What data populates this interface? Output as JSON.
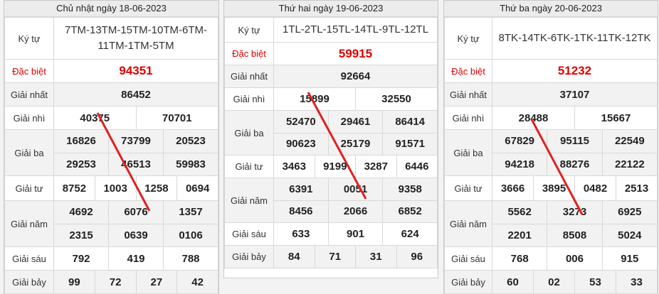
{
  "panels": [
    {
      "date": "Chủ nhật ngày 18-06-2023",
      "kytu_label": "Ký tự",
      "kytu": "7TM-13TM-15TM-10TM-6TM-11TM-1TM-5TM",
      "rows": [
        {
          "label": "Đặc biệt",
          "values": [
            "94351"
          ]
        },
        {
          "label": "Giải nhất",
          "values": [
            "86452"
          ]
        },
        {
          "label": "Giải nhì",
          "values": [
            "40375",
            "70701"
          ]
        },
        {
          "label": "Giải ba",
          "values": [
            "16826",
            "73799",
            "20523",
            "29253",
            "46513",
            "59983"
          ]
        },
        {
          "label": "Giải tư",
          "values": [
            "8752",
            "1003",
            "1258",
            "0694"
          ]
        },
        {
          "label": "Giải năm",
          "values": [
            "4692",
            "6076",
            "1357",
            "2315",
            "0639",
            "0106"
          ]
        },
        {
          "label": "Giải sáu",
          "values": [
            "792",
            "419",
            "788"
          ]
        },
        {
          "label": "Giải bảy",
          "values": [
            "99",
            "72",
            "27",
            "42"
          ]
        }
      ]
    },
    {
      "date": "Thứ hai ngày 19-06-2023",
      "kytu_label": "Ký tự",
      "kytu": "1TL-2TL-15TL-14TL-9TL-12TL",
      "rows": [
        {
          "label": "Đặc biệt",
          "values": [
            "59915"
          ]
        },
        {
          "label": "Giải nhất",
          "values": [
            "92664"
          ]
        },
        {
          "label": "Giải nhì",
          "values": [
            "15899",
            "32550"
          ]
        },
        {
          "label": "Giải ba",
          "values": [
            "52470",
            "29461",
            "86414",
            "90623",
            "25179",
            "91571"
          ]
        },
        {
          "label": "Giải tư",
          "values": [
            "3463",
            "9199",
            "3287",
            "6446"
          ]
        },
        {
          "label": "Giải năm",
          "values": [
            "6391",
            "0051",
            "9358",
            "8456",
            "2066",
            "6852"
          ]
        },
        {
          "label": "Giải sáu",
          "values": [
            "633",
            "901",
            "624"
          ]
        },
        {
          "label": "Giải bảy",
          "values": [
            "84",
            "71",
            "31",
            "96"
          ]
        }
      ]
    },
    {
      "date": "Thứ ba ngày 20-06-2023",
      "kytu_label": "Ký tự",
      "kytu": "8TK-14TK-6TK-1TK-11TK-12TK",
      "rows": [
        {
          "label": "Đặc biệt",
          "values": [
            "51232"
          ]
        },
        {
          "label": "Giải nhất",
          "values": [
            "37107"
          ]
        },
        {
          "label": "Giải nhì",
          "values": [
            "28488",
            "15667"
          ]
        },
        {
          "label": "Giải ba",
          "values": [
            "67829",
            "95115",
            "22549",
            "94218",
            "88276",
            "22122"
          ]
        },
        {
          "label": "Giải tư",
          "values": [
            "3666",
            "3895",
            "0482",
            "2513"
          ]
        },
        {
          "label": "Giải năm",
          "values": [
            "5562",
            "3273",
            "6925",
            "2201",
            "8508",
            "5024"
          ]
        },
        {
          "label": "Giải sáu",
          "values": [
            "768",
            "006",
            "915"
          ]
        },
        {
          "label": "Giải bảy",
          "values": [
            "60",
            "02",
            "53",
            "33"
          ]
        }
      ]
    }
  ],
  "colors": {
    "special": "#e00000",
    "slash": "#e02020",
    "alt_row": "#f2f2f2"
  }
}
